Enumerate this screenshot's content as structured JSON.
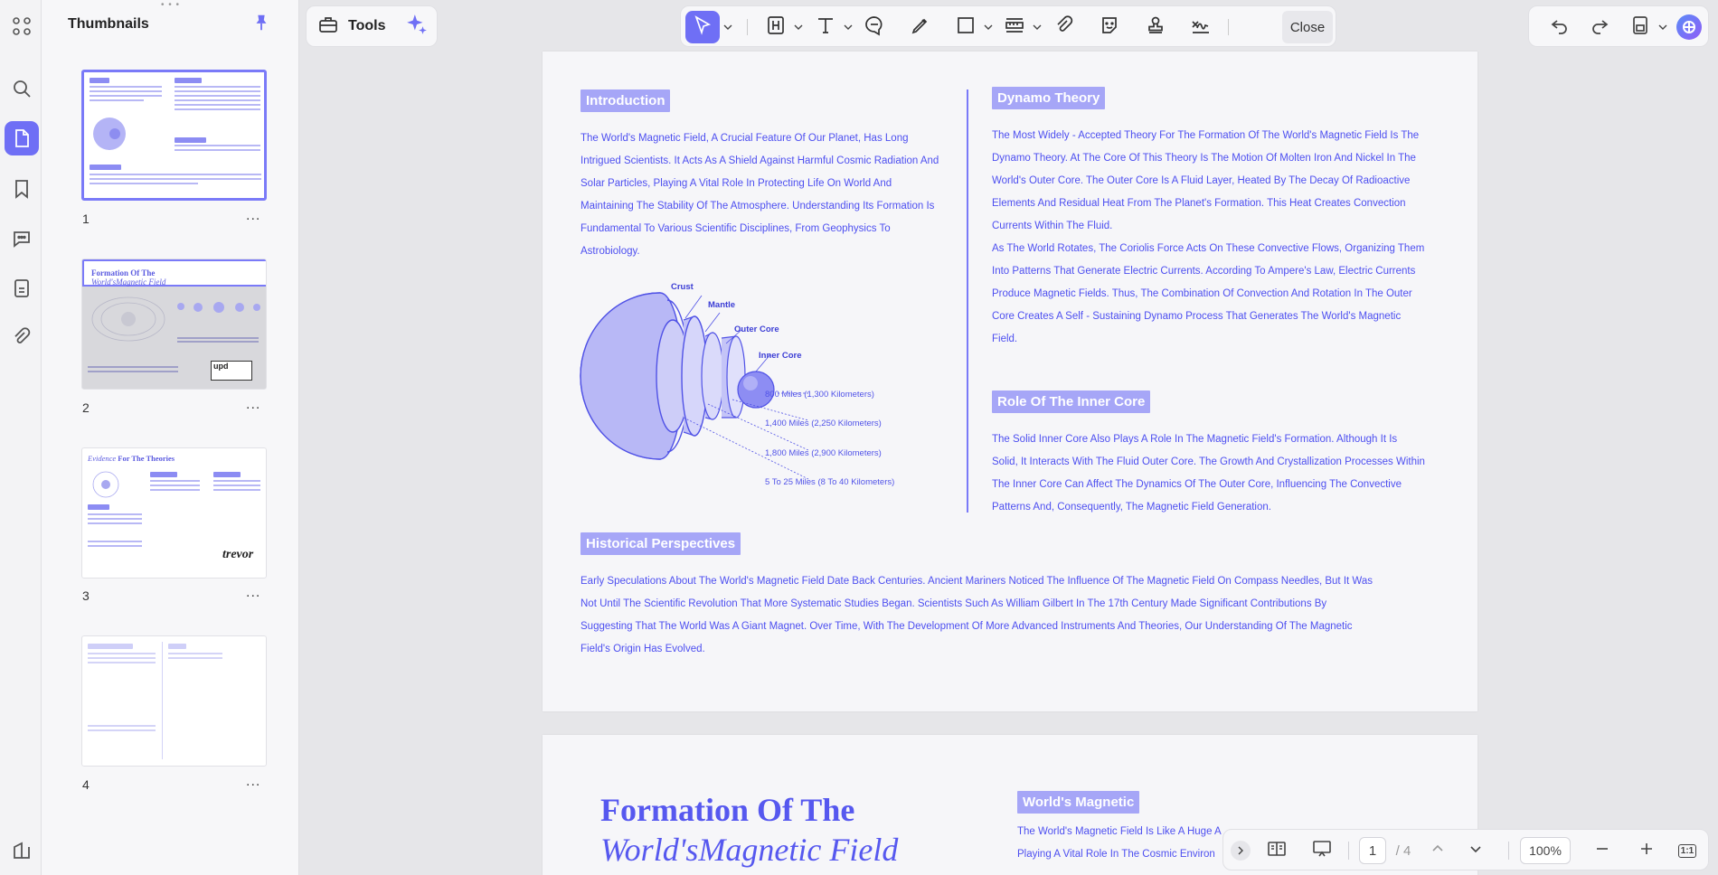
{
  "sidebar": {
    "title": "Thumbnails",
    "pages": [
      {
        "number": "1",
        "more": "..."
      },
      {
        "number": "2",
        "more": "..."
      },
      {
        "number": "3",
        "more": "..."
      },
      {
        "number": "4",
        "more": "..."
      }
    ],
    "thumb_texts": {
      "p2_title_line1": "Formation Of The",
      "p2_title_line2": "World'sMagnetic Field",
      "p2_logo": "upd",
      "p3_title_word1": "Evidence",
      "p3_title_rest": "For The Theories",
      "p3_signature": "trevor"
    }
  },
  "toolbar": {
    "tools_label": "Tools",
    "close_label": "Close"
  },
  "page1": {
    "intro_head": "Introduction",
    "intro_body": "The World's Magnetic Field, A Crucial Feature Of Our Planet, Has Long Intrigued Scientists. It Acts As A Shield Against Harmful Cosmic Radiation And Solar Particles, Playing A Vital Role In Protecting Life On World And Maintaining The Stability Of The Atmosphere. Understanding Its Formation Is Fundamental To Various Scientific Disciplines, From Geophysics To Astrobiology.",
    "diagram": {
      "crust": "Crust",
      "mantle": "Mantle",
      "outer_core": "Outer Core",
      "inner_core": "Inner Core",
      "d1": "800 Miles (1,300 Kilometers)",
      "d2": "1,400 Miles (2,250 Kilometers)",
      "d3": "1,800 Miles (2,900 Kilometers)",
      "d4": "5 To 25 Miles (8 To 40 Kilometers)"
    },
    "dynamo_head": "Dynamo Theory",
    "dynamo_p1": "The Most Widely - Accepted Theory For The Formation Of The World's Magnetic Field Is The Dynamo Theory. At The Core Of This Theory Is The Motion Of Molten Iron And Nickel In The World's Outer Core. The Outer Core Is A Fluid Layer, Heated By The Decay Of Radioactive Elements And Residual Heat From The Planet's Formation. This Heat Creates Convection Currents Within The Fluid.",
    "dynamo_p2": "As The World Rotates, The Coriolis Force Acts On These Convective Flows, Organizing Them Into Patterns That Generate Electric Currents. According To Ampere's Law, Electric Currents Produce Magnetic Fields. Thus, The Combination Of Convection And Rotation In The Outer Core Creates A Self - Sustaining Dynamo Process That Generates The World's Magnetic Field.",
    "inner_head": "Role Of The Inner Core",
    "inner_body": "The Solid Inner Core Also Plays A Role In The Magnetic Field's Formation. Although It Is Solid, It Interacts With The Fluid Outer Core. The Growth And Crystallization Processes Within The Inner Core Can Affect The Dynamics Of The Outer Core, Influencing The Convective Patterns And, Consequently, The Magnetic Field Generation.",
    "hist_head": "Historical Perspectives",
    "hist_body": "Early Speculations About The World's Magnetic Field Date Back Centuries. Ancient Mariners Noticed The Influence Of The Magnetic Field On Compass Needles, But It Was Not Until The Scientific Revolution That More Systematic Studies Began. Scientists Such As William Gilbert In The 17th Century Made Significant Contributions By Suggesting That The World Was A Giant Magnet. Over Time, With The Development Of More Advanced Instruments And Theories, Our Understanding Of The Magnetic Field's Origin Has Evolved."
  },
  "page2": {
    "title_line1": "Formation Of The",
    "title_line2": "World'sMagnetic Field",
    "head": "World's Magnetic",
    "line1": "The World's Magnetic Field Is Like A Huge A",
    "line2": "Playing A Vital Role In The Cosmic Environ"
  },
  "bottom": {
    "current_page": "1",
    "total_pages": "/ 4",
    "zoom": "100%",
    "fit_label": "1:1"
  }
}
